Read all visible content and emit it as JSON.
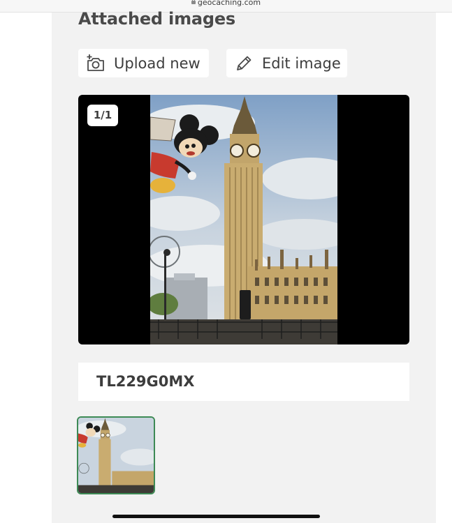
{
  "browser": {
    "domain": "geocaching.com"
  },
  "section": {
    "title": "Attached images"
  },
  "actions": {
    "upload_label": "Upload new",
    "edit_label": "Edit image"
  },
  "viewer": {
    "counter": "1/1"
  },
  "image": {
    "caption": "TL229G0MX"
  },
  "icons": {
    "upload": "add-photo-icon",
    "edit": "pencil-icon"
  },
  "colors": {
    "panel": "#f2f2f2",
    "selected_thumb_border": "#3d8a55",
    "text": "#3d3d3d"
  }
}
